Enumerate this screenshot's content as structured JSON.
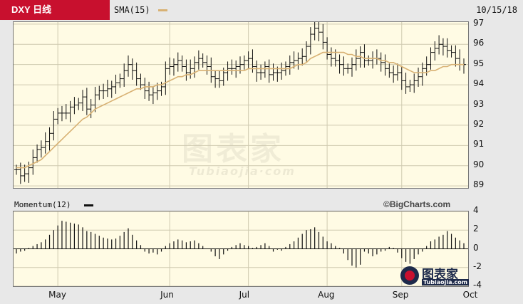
{
  "header": {
    "ticker": "DXY 日线",
    "indicator": "SMA(15)",
    "date": "10/15/18",
    "sma_color": "#d8b173",
    "brand_color": "#c8102e"
  },
  "momentum_panel": {
    "label": "Momentum(12)",
    "credit": "©BigCharts.com"
  },
  "watermark": {
    "main": "图表家",
    "sub": "Tubiaojia·com",
    "logo_text": "图表家",
    "logo_sub": "Tubiaojia.com"
  },
  "chart_data": [
    {
      "type": "ohlc",
      "title": "DXY 日线",
      "yticks": [
        89,
        90,
        91,
        92,
        93,
        94,
        95,
        96,
        97
      ],
      "ylim": [
        88.9,
        97.1
      ],
      "xticks": [
        "May",
        "Jun",
        "Jul",
        "Aug",
        "Sep",
        "Oct"
      ],
      "grid": true,
      "series": [
        {
          "name": "DXY",
          "style": "ohlc-bars",
          "values": [
            89.8,
            89.5,
            89.6,
            89.9,
            90.4,
            90.8,
            90.9,
            91.2,
            91.6,
            92.3,
            92.6,
            92.6,
            92.6,
            92.9,
            93.0,
            93.1,
            93.4,
            92.8,
            93.0,
            93.5,
            93.7,
            93.7,
            93.8,
            93.9,
            94.1,
            94.3,
            94.7,
            95.0,
            94.7,
            94.3,
            94.0,
            93.7,
            93.5,
            93.6,
            93.7,
            93.9,
            94.8,
            94.9,
            95.0,
            95.2,
            94.9,
            94.6,
            94.8,
            95.1,
            95.3,
            95.1,
            94.9,
            94.4,
            94.3,
            94.2,
            94.6,
            94.8,
            94.8,
            94.9,
            95.0,
            95.2,
            95.3,
            94.9,
            94.6,
            94.6,
            94.9,
            94.5,
            94.6,
            94.6,
            94.7,
            94.9,
            95.1,
            95.2,
            95.3,
            95.4,
            95.9,
            96.5,
            96.8,
            96.6,
            96.1,
            95.5,
            95.3,
            95.2,
            95.0,
            94.8,
            94.8,
            95.0,
            95.3,
            95.6,
            95.2,
            95.2,
            95.3,
            95.3,
            95.1,
            94.8,
            94.6,
            94.5,
            94.6,
            94.2,
            93.9,
            94.0,
            94.2,
            94.4,
            94.8,
            95.0,
            95.6,
            95.8,
            96.0,
            95.9,
            95.7,
            95.6,
            95.3,
            95.0,
            95.0
          ]
        },
        {
          "name": "SMA(15)",
          "style": "line",
          "values": [
            89.9,
            89.9,
            89.9,
            90.0,
            90.1,
            90.2,
            90.3,
            90.5,
            90.7,
            90.9,
            91.1,
            91.3,
            91.5,
            91.7,
            91.9,
            92.1,
            92.3,
            92.4,
            92.6,
            92.8,
            92.9,
            93.0,
            93.1,
            93.2,
            93.3,
            93.4,
            93.5,
            93.6,
            93.7,
            93.8,
            93.8,
            93.9,
            93.9,
            93.9,
            94.0,
            94.0,
            94.1,
            94.2,
            94.3,
            94.4,
            94.4,
            94.5,
            94.5,
            94.6,
            94.7,
            94.7,
            94.7,
            94.7,
            94.7,
            94.7,
            94.7,
            94.7,
            94.7,
            94.7,
            94.7,
            94.7,
            94.8,
            94.8,
            94.8,
            94.8,
            94.8,
            94.8,
            94.8,
            94.8,
            94.8,
            94.8,
            94.8,
            94.9,
            95.0,
            95.0,
            95.1,
            95.3,
            95.4,
            95.5,
            95.6,
            95.6,
            95.6,
            95.6,
            95.6,
            95.6,
            95.5,
            95.5,
            95.4,
            95.4,
            95.3,
            95.3,
            95.3,
            95.3,
            95.2,
            95.2,
            95.1,
            95.1,
            95.0,
            94.9,
            94.8,
            94.7,
            94.6,
            94.6,
            94.6,
            94.6,
            94.7,
            94.7,
            94.8,
            94.9,
            94.9,
            95.0,
            95.0,
            95.0,
            95.0
          ]
        }
      ]
    },
    {
      "type": "bar",
      "title": "Momentum(12)",
      "yticks": [
        -4,
        -2,
        0,
        2,
        4
      ],
      "ylim": [
        -4,
        4
      ],
      "grid": true,
      "series": [
        {
          "name": "Momentum(12)",
          "values": [
            -0.5,
            -0.3,
            -0.2,
            0.1,
            0.3,
            0.5,
            0.7,
            1.0,
            1.5,
            2.0,
            2.5,
            3.0,
            2.9,
            2.8,
            2.7,
            2.6,
            2.3,
            1.9,
            1.8,
            1.6,
            1.4,
            1.2,
            1.1,
            1.0,
            1.1,
            1.4,
            1.8,
            2.2,
            1.5,
            0.9,
            0.4,
            -0.3,
            -0.5,
            -0.4,
            -0.6,
            -0.3,
            0.3,
            0.6,
            0.8,
            1.0,
            0.9,
            0.7,
            0.8,
            0.9,
            0.6,
            0.3,
            0.0,
            -0.3,
            -0.8,
            -1.1,
            -0.6,
            -0.2,
            0.2,
            0.4,
            0.6,
            0.4,
            0.3,
            0.1,
            0.2,
            0.4,
            0.6,
            0.3,
            -0.3,
            -0.1,
            -0.2,
            0.2,
            0.5,
            0.8,
            1.2,
            1.6,
            2.0,
            2.1,
            2.3,
            1.8,
            1.3,
            0.8,
            0.6,
            0.3,
            0.1,
            -0.5,
            -1.2,
            -1.8,
            -2.0,
            -1.7,
            -0.3,
            -0.5,
            -0.8,
            -0.6,
            -0.3,
            -0.2,
            0.2,
            0.1,
            -0.4,
            -1.0,
            -1.4,
            -1.6,
            -1.1,
            -0.6,
            -0.3,
            0.3,
            0.8,
            1.0,
            1.3,
            1.5,
            1.9,
            1.6,
            1.2,
            0.9,
            0.6
          ]
        }
      ]
    }
  ]
}
